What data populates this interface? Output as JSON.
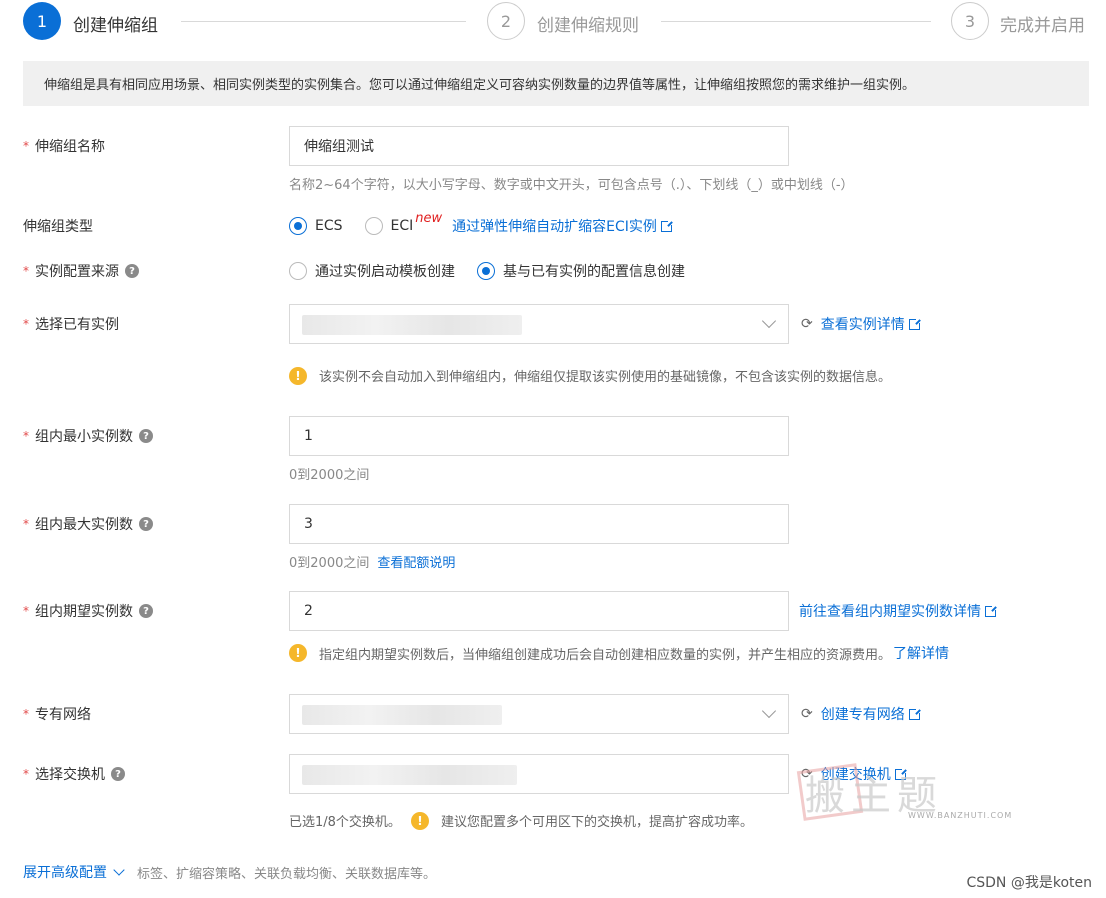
{
  "steps": [
    {
      "number": "1",
      "label": "创建伸缩组",
      "active": true
    },
    {
      "number": "2",
      "label": "创建伸缩规则",
      "active": false
    },
    {
      "number": "3",
      "label": "完成并启用",
      "active": false
    }
  ],
  "info": "伸缩组是具有相同应用场景、相同实例类型的实例集合。您可以通过伸缩组定义可容纳实例数量的边界值等属性，让伸缩组按照您的需求维护一组实例。",
  "fields": {
    "name": {
      "label": "伸缩组名称",
      "value": "伸缩组测试",
      "hint": "名称2~64个字符，以大小写字母、数字或中文开头，可包含点号（.）、下划线（_）或中划线（-）"
    },
    "type": {
      "label": "伸缩组类型",
      "options": [
        "ECS",
        "ECI"
      ],
      "selected": "ECS",
      "new_tag": "new",
      "link": "通过弹性伸缩自动扩缩容ECI实例"
    },
    "source": {
      "label": "实例配置来源",
      "options": [
        "通过实例启动模板创建",
        "基与已有实例的配置信息创建"
      ],
      "selected": "基与已有实例的配置信息创建"
    },
    "instance": {
      "label": "选择已有实例",
      "link": "查看实例详情",
      "warning": "该实例不会自动加入到伸缩组内，伸缩组仅提取该实例使用的基础镜像，不包含该实例的数据信息。"
    },
    "min": {
      "label": "组内最小实例数",
      "value": "1",
      "hint": "0到2000之间"
    },
    "max": {
      "label": "组内最大实例数",
      "value": "3",
      "hint": "0到2000之间",
      "hint_link": "查看配额说明"
    },
    "desired": {
      "label": "组内期望实例数",
      "value": "2",
      "link": "前往查看组内期望实例数详情",
      "warning": "指定组内期望实例数后，当伸缩组创建成功后会自动创建相应数量的实例，并产生相应的资源费用。",
      "warning_link": "了解详情"
    },
    "vpc": {
      "label": "专有网络",
      "link": "创建专有网络"
    },
    "vswitch": {
      "label": "选择交换机",
      "link": "创建交换机",
      "hint": "已选1/8个交换机。",
      "warning": "建议您配置多个可用区下的交换机，提高扩容成功率。"
    }
  },
  "advanced": {
    "label": "展开高级配置",
    "desc": "标签、扩缩容策略、关联负载均衡、关联数据库等。"
  },
  "watermark": {
    "big": "搬主题",
    "small": "WWW.BANZHUTI.COM"
  },
  "footer": "CSDN @我是koten",
  "colors": {
    "primary": "#0a6fd6",
    "required": "#e24a4a",
    "warning": "#f5b72b"
  }
}
